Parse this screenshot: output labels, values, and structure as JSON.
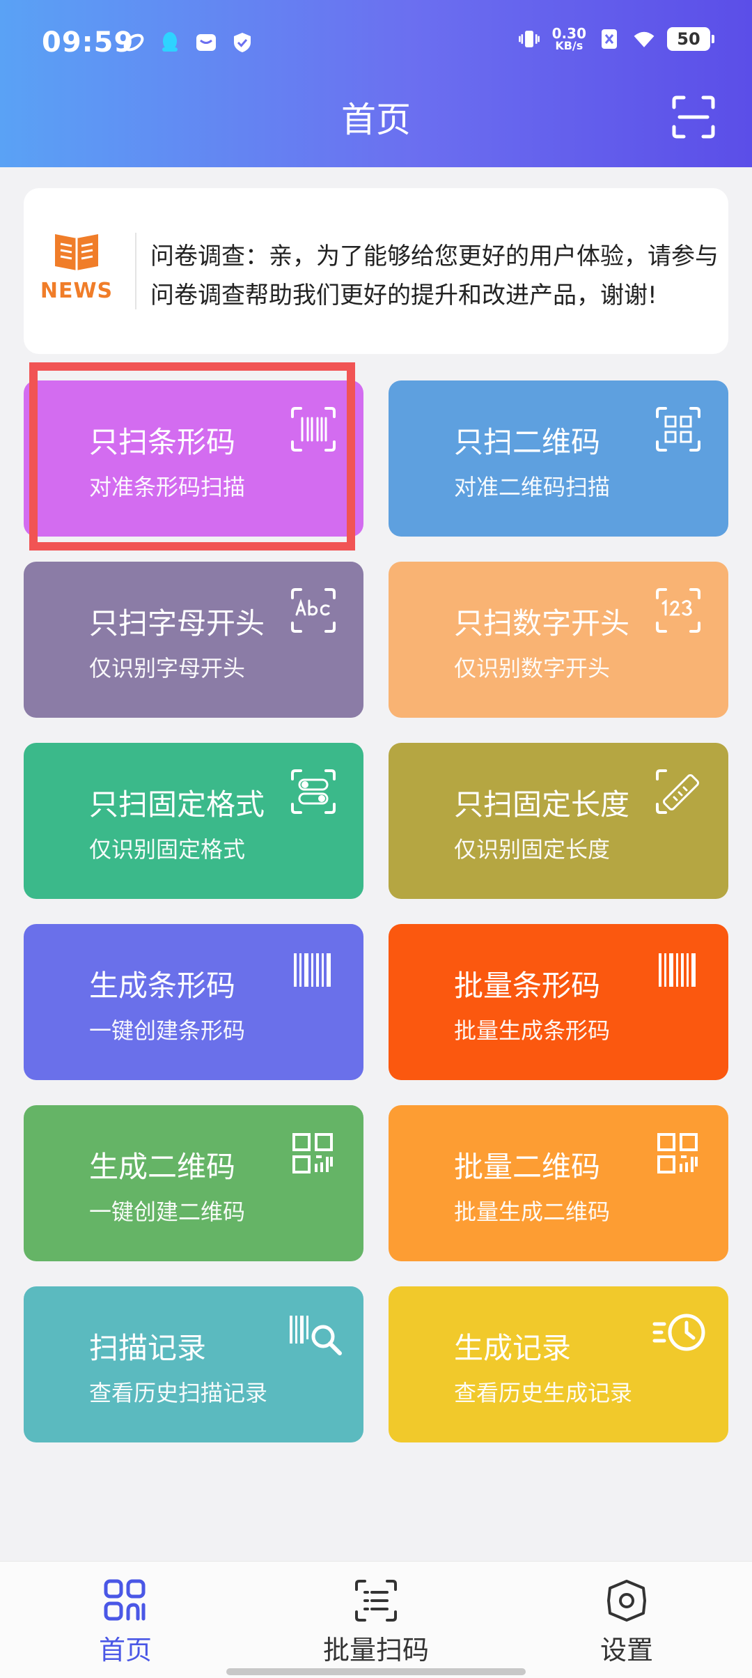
{
  "status_bar": {
    "time": "09:59",
    "net_speed_value": "0.30",
    "net_speed_unit": "KB/s",
    "battery": "50"
  },
  "header": {
    "title": "首页"
  },
  "news": {
    "label": "NEWS",
    "text": "问卷调查：亲，为了能够给您更好的用户体验，请参与问卷调查帮助我们更好的提升和改进产品，谢谢!"
  },
  "tiles": [
    {
      "title": "只扫条形码",
      "subtitle": "对准条形码扫描",
      "color": "#d36cf0",
      "icon": "barcode-scan-icon"
    },
    {
      "title": "只扫二维码",
      "subtitle": "对准二维码扫描",
      "color": "#5ea0df",
      "icon": "qrcode-scan-icon"
    },
    {
      "title": "只扫字母开头",
      "subtitle": "仅识别字母开头",
      "color": "#8b7ca6",
      "icon": "abc-scan-icon"
    },
    {
      "title": "只扫数字开头",
      "subtitle": "仅识别数字开头",
      "color": "#f9b373",
      "icon": "number-scan-icon"
    },
    {
      "title": "只扫固定格式",
      "subtitle": "仅识别固定格式",
      "color": "#3bb98a",
      "icon": "format-scan-icon"
    },
    {
      "title": "只扫固定长度",
      "subtitle": "仅识别固定长度",
      "color": "#b5a642",
      "icon": "ruler-icon"
    },
    {
      "title": "生成条形码",
      "subtitle": "一键创建条形码",
      "color": "#6a70ea",
      "icon": "barcode-icon"
    },
    {
      "title": "批量条形码",
      "subtitle": "批量生成条形码",
      "color": "#fb580f",
      "icon": "barcode-batch-icon"
    },
    {
      "title": "生成二维码",
      "subtitle": "一键创建二维码",
      "color": "#65b466",
      "icon": "qrcode-icon"
    },
    {
      "title": "批量二维码",
      "subtitle": "批量生成二维码",
      "color": "#fd9d33",
      "icon": "qrcode-batch-icon"
    },
    {
      "title": "扫描记录",
      "subtitle": "查看历史扫描记录",
      "color": "#5bbabf",
      "icon": "scan-history-icon"
    },
    {
      "title": "生成记录",
      "subtitle": "查看历史生成记录",
      "color": "#f1c92b",
      "icon": "generate-history-icon"
    }
  ],
  "bottom_nav": {
    "items": [
      {
        "label": "首页",
        "active": true
      },
      {
        "label": "批量扫码",
        "active": false
      },
      {
        "label": "设置",
        "active": false
      }
    ],
    "active_color": "#4a57e6"
  }
}
